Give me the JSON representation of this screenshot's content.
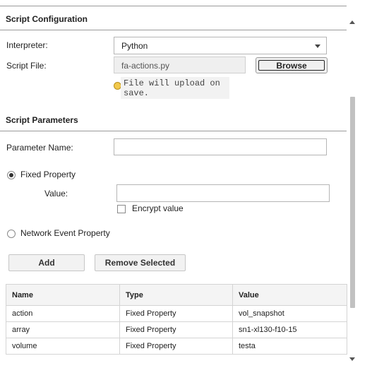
{
  "script_config": {
    "title": "Script Configuration",
    "interpreter_label": "Interpreter:",
    "interpreter_value": "Python",
    "script_file_label": "Script File:",
    "script_file_value": "fa-actions.py",
    "browse_label": "Browse",
    "upload_note": "File will upload on save."
  },
  "script_params": {
    "title": "Script Parameters",
    "param_name_label": "Parameter Name:",
    "param_name_value": "",
    "fixed_property_label": "Fixed Property",
    "value_label": "Value:",
    "value_value": "",
    "encrypt_label": "Encrypt value",
    "network_event_label": "Network Event Property",
    "add_label": "Add",
    "remove_label": "Remove Selected"
  },
  "table": {
    "columns": [
      "Name",
      "Type",
      "Value"
    ],
    "rows": [
      [
        "action",
        "Fixed Property",
        "vol_snapshot"
      ],
      [
        "array",
        "Fixed Property",
        "sn1-xl130-f10-15"
      ],
      [
        "volume",
        "Fixed Property",
        "testa"
      ]
    ]
  },
  "state": {
    "fixed_property_selected": true,
    "network_event_selected": false,
    "encrypt_checked": false
  },
  "icons": [
    "info-icon",
    "chevron-down-icon",
    "scroll-up-icon",
    "scroll-down-icon"
  ],
  "colors": {
    "note_background": "#f2f2f2",
    "info_dot": "#f2c94c",
    "rule": "#9a9a9a"
  }
}
